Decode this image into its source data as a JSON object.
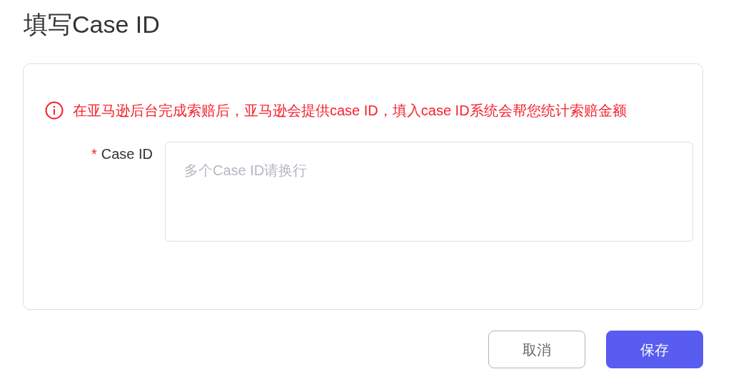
{
  "dialog": {
    "title": "填写Case ID"
  },
  "notice": {
    "text": "在亚马逊后台完成索赔后，亚马逊会提供case ID，填入case ID系统会帮您统计索赔金额"
  },
  "field": {
    "required_mark": "*",
    "label": "Case ID",
    "placeholder": "多个Case ID请换行"
  },
  "buttons": [
    {
      "label": "取消",
      "kind": "secondary"
    },
    {
      "label": "保存",
      "kind": "primary"
    }
  ]
}
